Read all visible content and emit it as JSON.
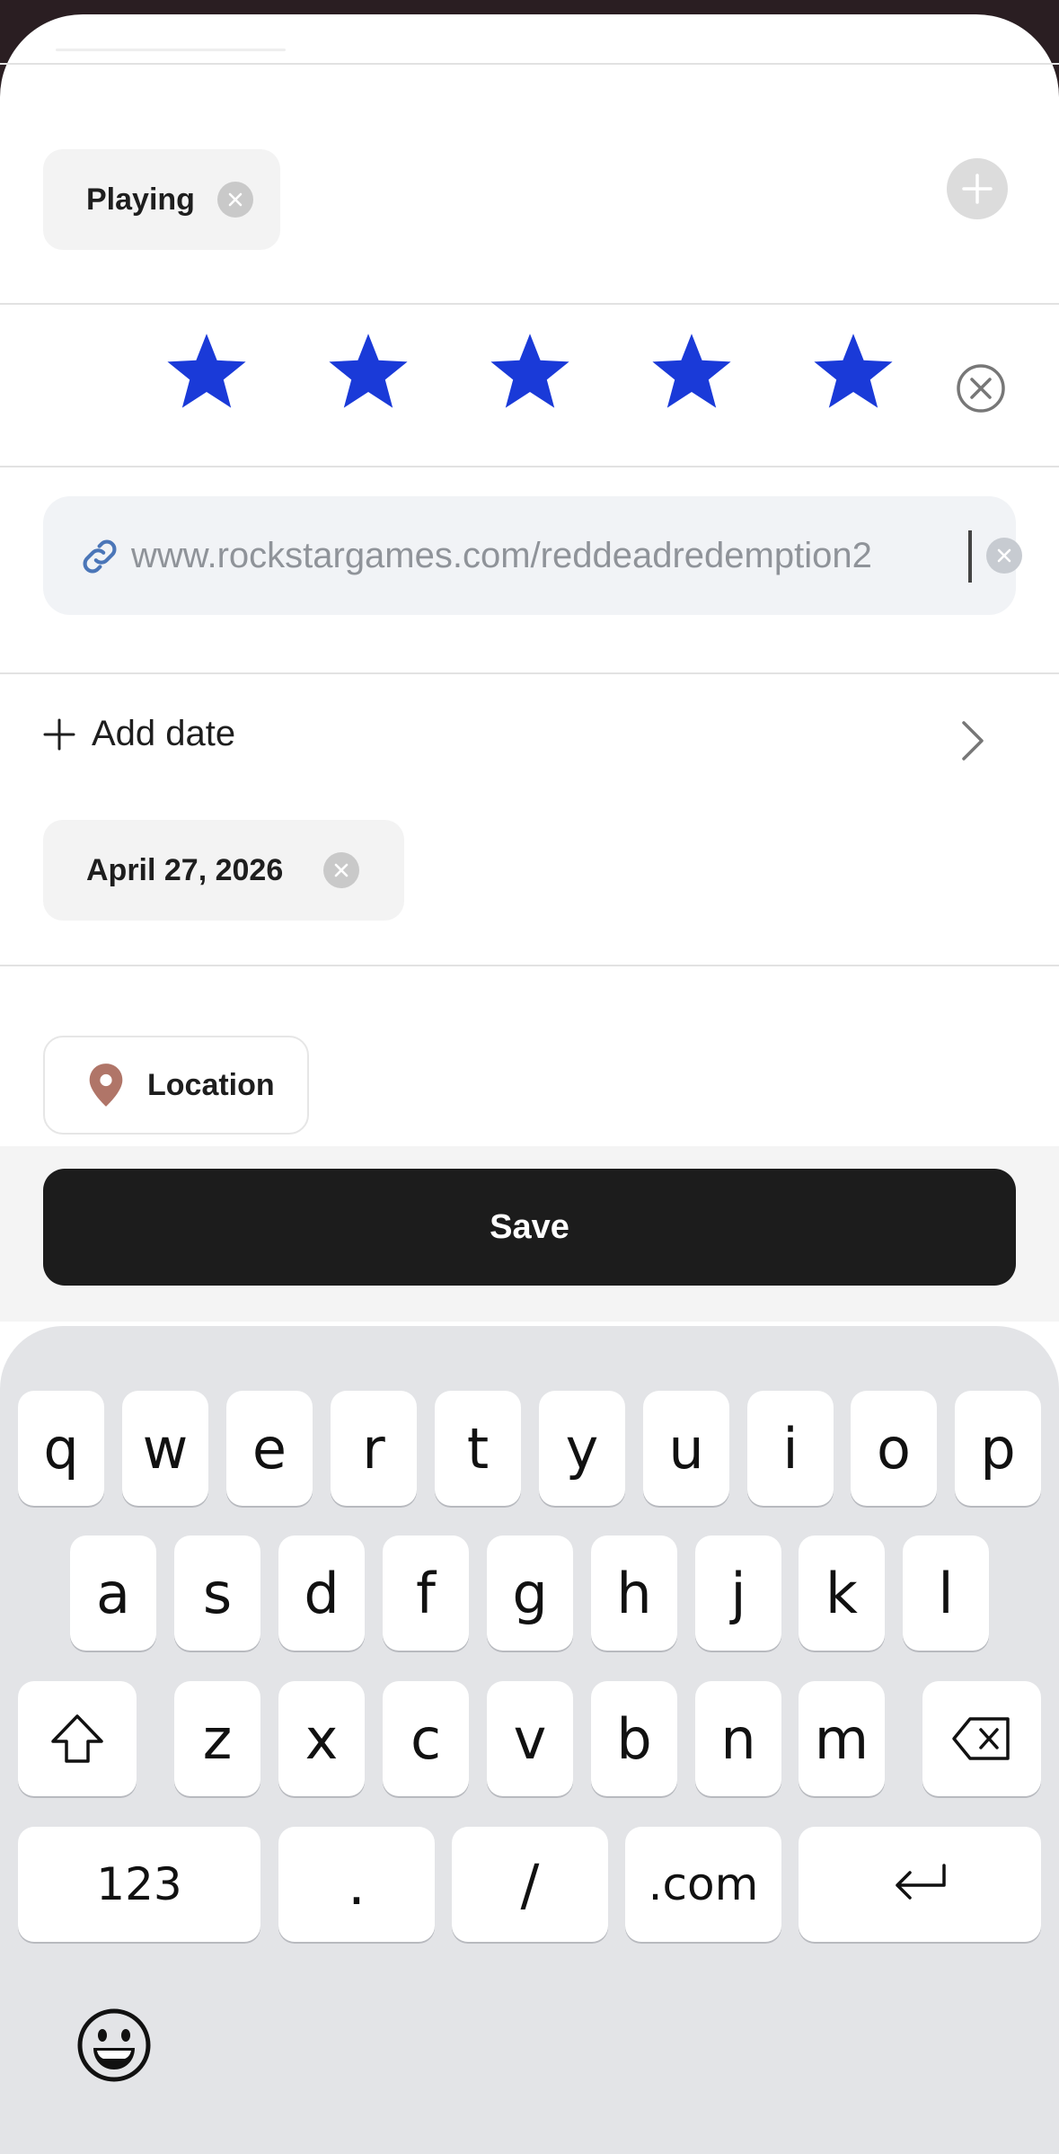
{
  "status_chip": {
    "label": "Playing"
  },
  "rating": {
    "value": 5,
    "max": 5,
    "star_color": "#1a3ad8"
  },
  "url_field": {
    "value": "www.rockstargames.com/reddeadredemption2"
  },
  "date": {
    "add_label": "Add date",
    "selected": "April 27, 2026"
  },
  "location": {
    "label": "Location"
  },
  "actions": {
    "save_label": "Save"
  },
  "keyboard": {
    "row1": [
      "q",
      "w",
      "e",
      "r",
      "t",
      "y",
      "u",
      "i",
      "o",
      "p"
    ],
    "row2": [
      "a",
      "s",
      "d",
      "f",
      "g",
      "h",
      "j",
      "k",
      "l"
    ],
    "row3": [
      "z",
      "x",
      "c",
      "v",
      "b",
      "n",
      "m"
    ],
    "numbers_label": "123",
    "dot_label": ".",
    "slash_label": "/",
    "dotcom_label": ".com"
  },
  "icons": {
    "remove": "close-circle-icon",
    "add": "plus-icon",
    "link": "link-icon",
    "chevron": "chevron-right-icon",
    "location": "map-pin-icon",
    "shift": "shift-icon",
    "backspace": "backspace-icon",
    "return": "return-icon",
    "emoji": "emoji-icon"
  }
}
